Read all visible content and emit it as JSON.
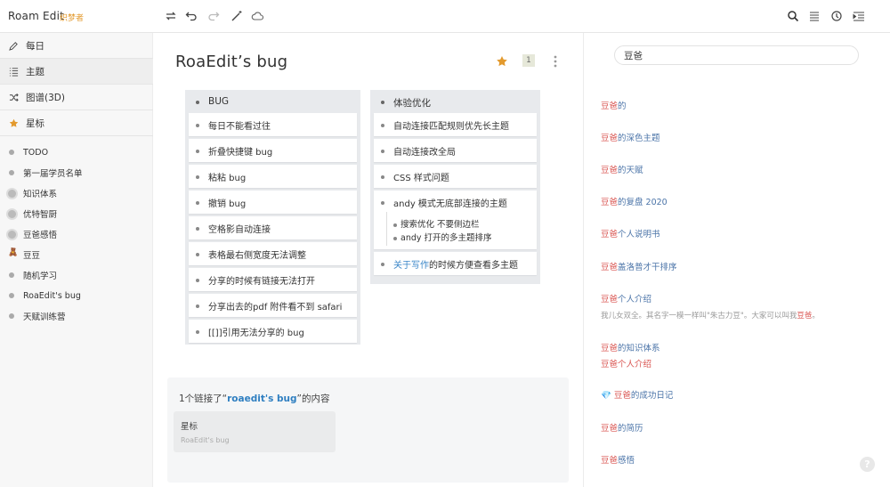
{
  "app": {
    "title": "Roam Edit",
    "badge": "织梦者"
  },
  "sidebar": {
    "nav": [
      {
        "label": "每日",
        "icon": "edit-icon"
      },
      {
        "label": "主题",
        "icon": "list-icon"
      },
      {
        "label": "图谱(3D)",
        "icon": "shuffle-icon"
      },
      {
        "label": "星标",
        "icon": "star-icon"
      }
    ],
    "favorites": [
      {
        "label": "TODO"
      },
      {
        "label": "第一届学员名单"
      },
      {
        "label": "知识体系"
      },
      {
        "label": "优特智厨"
      },
      {
        "label": "豆爸感悟"
      },
      {
        "label": "豆豆",
        "emoji": "🧸"
      },
      {
        "label": "随机学习"
      },
      {
        "label": "RoaEdit's bug"
      },
      {
        "label": "天赋训练营"
      }
    ]
  },
  "page": {
    "title": "RoaEdit’s bug",
    "ref_count": "1",
    "columns": [
      {
        "title": "BUG",
        "cards": [
          "每日不能看过往",
          "折叠快捷键 bug",
          "粘粘 bug",
          "撤销 bug",
          "空格影自动连接",
          "表格最右侧宽度无法调整",
          "分享的时候有链接无法打开",
          "分享出去的pdf 附件看不到 safari",
          "[[]]引用无法分享的 bug"
        ]
      },
      {
        "title": "体验优化",
        "cards": [
          "自动连接匹配规则优先长主题",
          "自动连接改全局",
          "CSS 样式问题",
          "andy 模式无底部连接的主题"
        ],
        "subitems": [
          "搜索优化 不要侧边栏",
          "andy 打开的多主题排序"
        ],
        "last_card": {
          "link": "关于写作",
          "rest": "的时候方便查看多主题"
        }
      }
    ],
    "references": {
      "prefix": "1个链接了“",
      "highlight": "roaedit's bug",
      "suffix": "”的内容",
      "card_title": "星标",
      "card_sub": "RoaEdit's bug"
    }
  },
  "search": {
    "value": "豆爸",
    "results": [
      {
        "hl": "豆爸",
        "rest": "的"
      },
      {
        "hl": "豆爸",
        "rest": "的深色主题"
      },
      {
        "hl": "豆爸",
        "rest": "的天赋"
      },
      {
        "hl": "豆爸",
        "rest": "的复盘 2020"
      },
      {
        "hl": "豆爸",
        "rest": "个人说明书"
      },
      {
        "hl": "豆爸",
        "rest": "盖洛普才干排序"
      },
      {
        "hl": "豆爸",
        "rest": "个人介绍"
      },
      {
        "hl": "豆爸",
        "rest": "的知识体系"
      },
      {
        "hl": "豆爸",
        "rest": "的成功日记",
        "emoji": "💎"
      },
      {
        "hl": "豆爸",
        "rest": "的简历"
      },
      {
        "hl": "豆爸",
        "rest": "感悟"
      }
    ],
    "snippet_7": {
      "pre": "我儿女双全。其名字一模一样叫\"朱古力豆\"。大家可以叫我",
      "hl": "豆爸",
      "post": "。"
    },
    "snippet_8": {
      "hl": "豆爸",
      "rest": "个人介绍"
    },
    "help": "?"
  },
  "colors": {
    "accent": "#e39a2e",
    "link": "#3a86c8",
    "highlight": "#d9534f"
  }
}
